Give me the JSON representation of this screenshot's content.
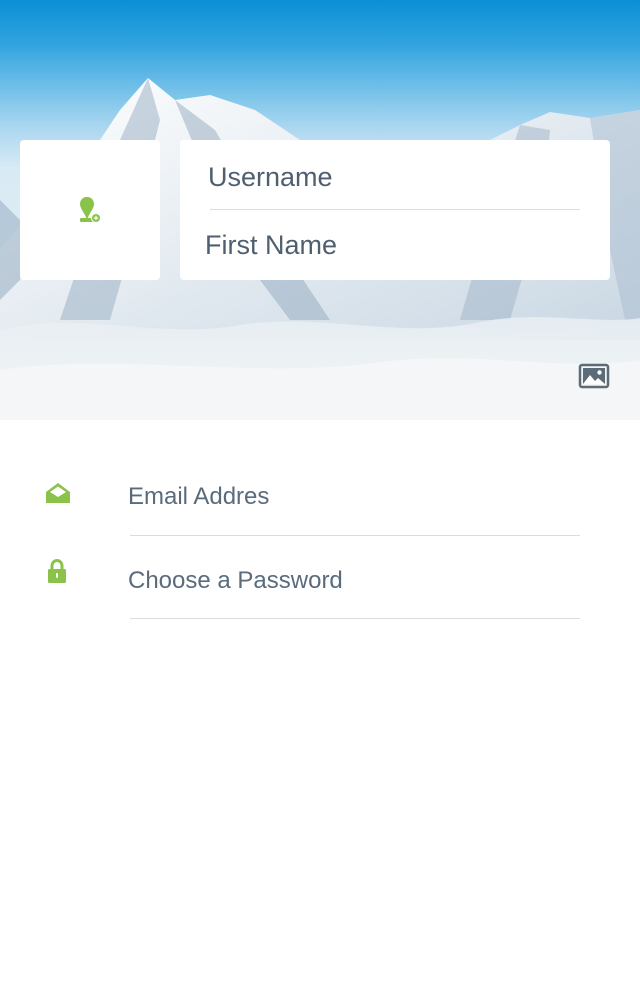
{
  "colors": {
    "accent": "#8bc34a",
    "text": "#4f5f6f",
    "divider": "#dcdcdc",
    "sky_top": "#0b8fd6",
    "card": "#ffffff"
  },
  "header": {
    "background": "snowy-mountain-photo",
    "avatar": {
      "icon": "user-add-icon"
    },
    "change_background": {
      "icon": "image-icon"
    },
    "fields": {
      "username": {
        "placeholder": "Username"
      },
      "first_name": {
        "placeholder": "First Name"
      }
    }
  },
  "form": {
    "email": {
      "icon": "envelope-open-icon",
      "placeholder": "Email Addres"
    },
    "password": {
      "icon": "lock-icon",
      "placeholder": "Choose a Password"
    }
  }
}
